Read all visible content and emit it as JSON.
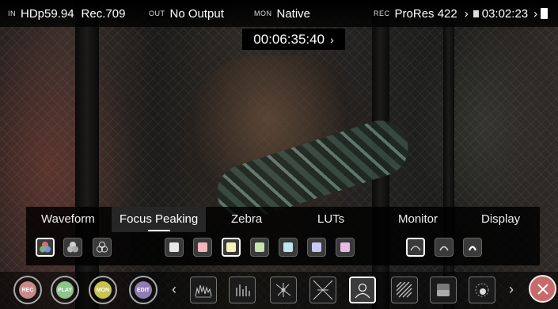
{
  "status_bar": {
    "input_label": "IN",
    "input_value": "HDp59.94",
    "color_space": "Rec.709",
    "output_label": "OUT",
    "output_value": "No Output",
    "monitor_label": "MON",
    "monitor_value": "Native",
    "rec_label": "REC",
    "codec": "ProRes 422",
    "remaining_time": "03:02:23"
  },
  "timecode": {
    "value": "00:06:35:40",
    "chevron": "›"
  },
  "menu": {
    "tabs": [
      "Waveform",
      "Focus Peaking",
      "Zebra",
      "LUTs",
      "Monitor",
      "Display"
    ],
    "active_tab": "Focus Peaking",
    "mode_options": [
      "rgb-circles-icon",
      "filled-circles-icon",
      "outline-circles-icon"
    ],
    "selected_mode": 0,
    "colors": [
      "#e8e8e8",
      "#f2b6bc",
      "#f4f2b8",
      "#c6e4b2",
      "#bfe4ee",
      "#c9c8f2",
      "#e6bce2"
    ],
    "selected_color": 2,
    "sensitivity_options": [
      "low-sensitivity-icon",
      "medium-sensitivity-icon",
      "high-sensitivity-icon"
    ],
    "selected_sensitivity": 0
  },
  "bottom_bar": {
    "mode_buttons": [
      {
        "label": "REC",
        "color": "#c7898a"
      },
      {
        "label": "PLAY",
        "color": "#8cc48a"
      },
      {
        "label": "MON",
        "color": "#c9c24f"
      },
      {
        "label": "EDIT",
        "color": "#8e7cb4"
      }
    ],
    "prev_chevron": "‹",
    "next_chevron": "›",
    "tools": [
      "waveform-tool-icon",
      "vectorscope-bars-icon",
      "crosshair-tool-icon",
      "anamorphic-tool-icon",
      "focus-peaking-tool-icon",
      "zebra-tool-icon",
      "false-color-tool-icon",
      "lut-tool-icon"
    ],
    "selected_tool": 4,
    "close_icon": "close-icon"
  }
}
